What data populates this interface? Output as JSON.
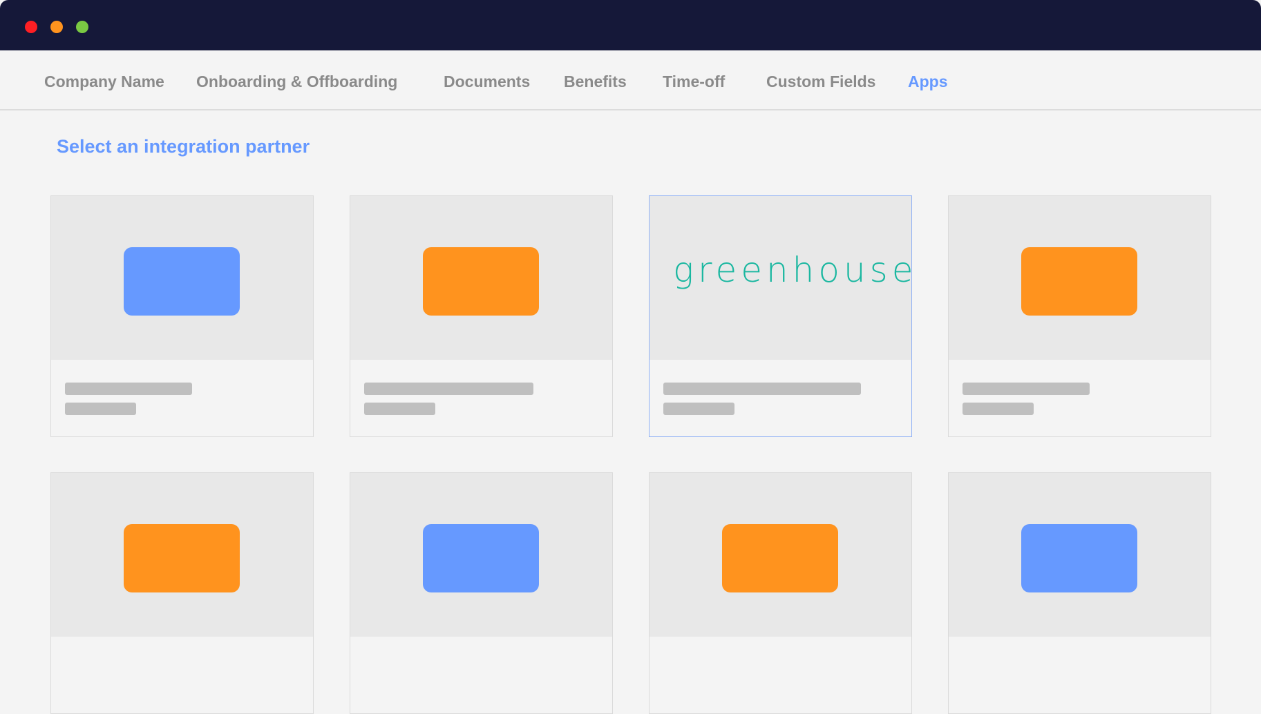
{
  "window": {
    "controls": [
      "close",
      "minimize",
      "maximize"
    ],
    "colors": {
      "close": "#ff1f24",
      "minimize": "#ff931e",
      "maximize": "#7ac943",
      "titlebar": "#151839"
    }
  },
  "nav": {
    "items": [
      {
        "label": "Company Name",
        "active": false
      },
      {
        "label": "Onboarding & Offboarding",
        "active": false
      },
      {
        "label": "Documents",
        "active": false
      },
      {
        "label": "Benefits",
        "active": false
      },
      {
        "label": "Time-off",
        "active": false
      },
      {
        "label": "Custom Fields",
        "active": false
      },
      {
        "label": "Apps",
        "active": true
      }
    ]
  },
  "page": {
    "heading": "Select an integration partner"
  },
  "colors": {
    "accent": "#6699ff",
    "blue_placeholder": "#6699ff",
    "orange_placeholder": "#ff931e",
    "greenhouse": "#1ab7a0"
  },
  "cards": [
    {
      "logo": "blue-placeholder",
      "selected": false
    },
    {
      "logo": "orange-placeholder",
      "selected": false
    },
    {
      "logo": "greenhouse",
      "logo_text": "greenhouse",
      "selected": true
    },
    {
      "logo": "orange-placeholder",
      "selected": false
    },
    {
      "logo": "orange-placeholder",
      "selected": false
    },
    {
      "logo": "blue-placeholder",
      "selected": false
    },
    {
      "logo": "orange-placeholder",
      "selected": false
    },
    {
      "logo": "blue-placeholder",
      "selected": false
    }
  ]
}
